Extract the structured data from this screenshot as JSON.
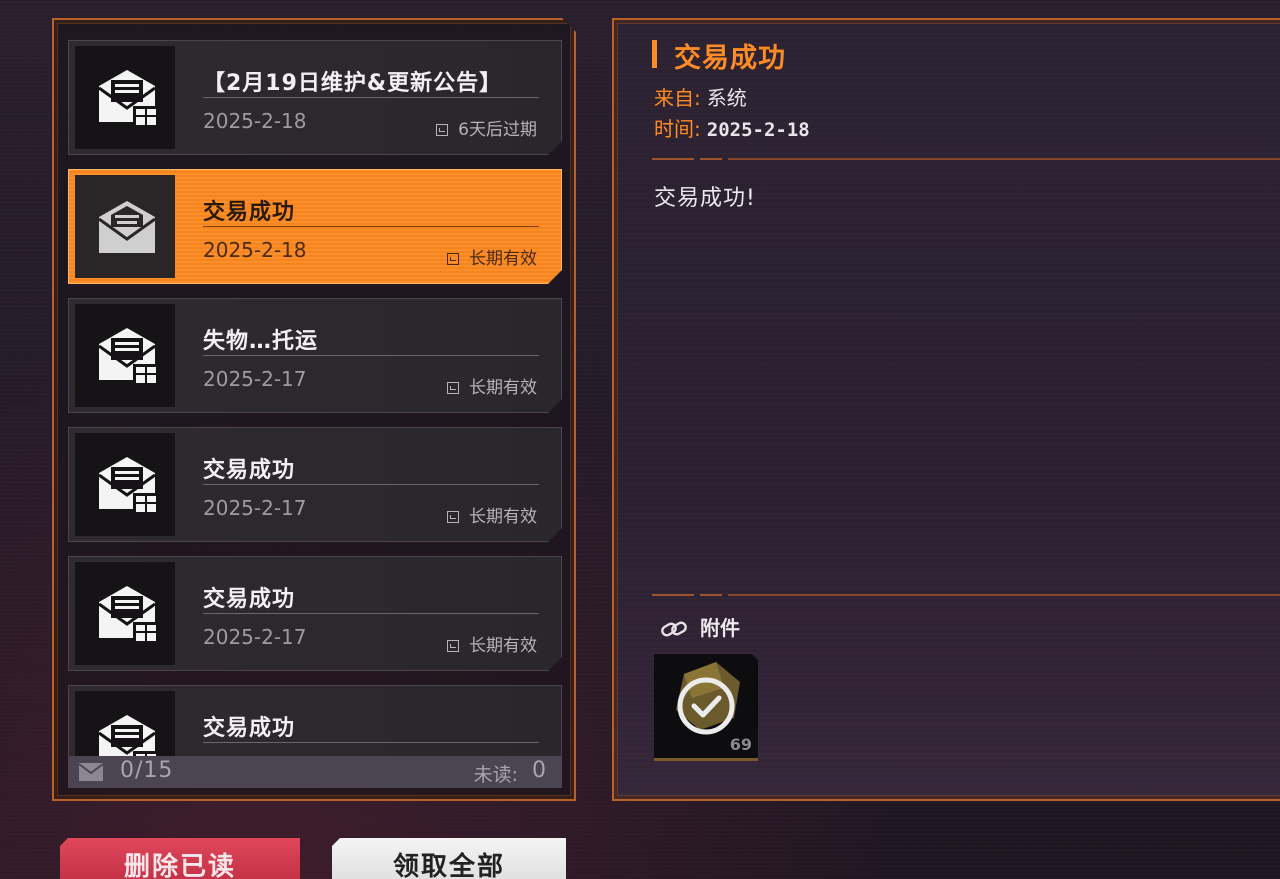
{
  "mail_list": {
    "items": [
      {
        "title": "【2月19日维护&更新公告】",
        "date": "2025-2-18",
        "expiry": "6天后过期",
        "icon": "envelope-gift-icon",
        "selected": false
      },
      {
        "title": "交易成功",
        "date": "2025-2-18",
        "expiry": "长期有效",
        "icon": "envelope-open-icon",
        "selected": true
      },
      {
        "title": "失物…托运",
        "date": "2025-2-17",
        "expiry": "长期有效",
        "icon": "envelope-gift-icon",
        "selected": false
      },
      {
        "title": "交易成功",
        "date": "2025-2-17",
        "expiry": "长期有效",
        "icon": "envelope-gift-icon",
        "selected": false
      },
      {
        "title": "交易成功",
        "date": "2025-2-17",
        "expiry": "长期有效",
        "icon": "envelope-gift-icon",
        "selected": false
      },
      {
        "title": "交易成功",
        "date": "",
        "expiry": "",
        "icon": "envelope-gift-icon",
        "selected": false
      }
    ],
    "status": {
      "count": "0/15",
      "unread_label": "未读:",
      "unread_value": "0"
    }
  },
  "detail": {
    "title": "交易成功",
    "from_label": "来自:",
    "from_value": "系统",
    "time_label": "时间:",
    "time_value": "2025-2-18",
    "body": "交易成功!",
    "attachments_label": "附件",
    "attachment": {
      "icon": "check-token-icon",
      "count": "69"
    }
  },
  "buttons": {
    "delete_read": "删除已读",
    "claim_all": "领取全部"
  },
  "colors": {
    "accent": "#ff8c24",
    "panel_border": "#b8612a",
    "selected_item": "#f78a26",
    "delete_button": "#c9334a"
  }
}
